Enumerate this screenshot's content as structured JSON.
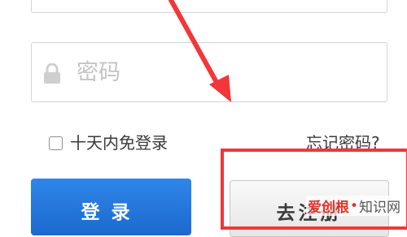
{
  "login_form": {
    "password_placeholder": "密码",
    "remember_label": "十天内免登录",
    "forgot_link": "忘记密码?",
    "login_button": "登录",
    "register_button": "去注册"
  },
  "watermark": {
    "brand": "爱创根",
    "site": "知识网"
  },
  "colors": {
    "annotation_red": "#f2363a",
    "login_blue": "#1f73d8"
  }
}
